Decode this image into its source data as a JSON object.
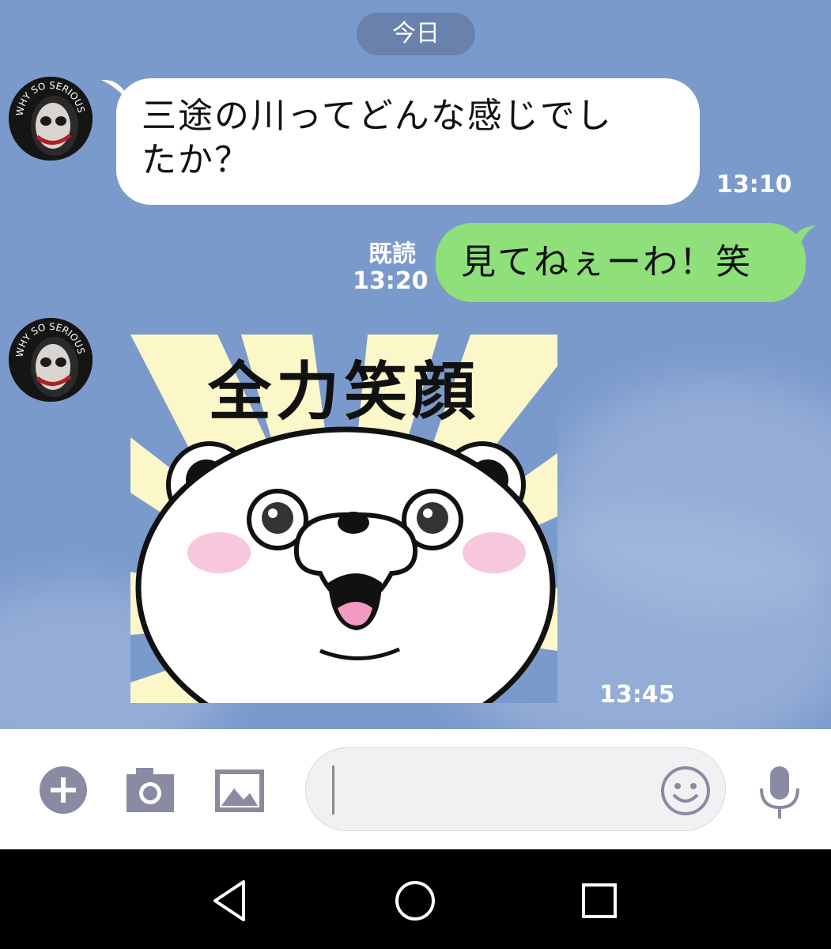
{
  "chat": {
    "date_divider": "今日",
    "messages": [
      {
        "direction": "incoming",
        "avatar_text": "WHY SO SERIOUS",
        "text_line1": "三途の川ってどんな感じでし",
        "text_line2": "たか？",
        "time": "13:10"
      },
      {
        "direction": "outgoing",
        "text": "見てねぇーわ！笑",
        "read_label": "既読",
        "time": "13:20"
      },
      {
        "direction": "incoming",
        "avatar_text": "WHY SO SERIOUS",
        "sticker_text": "全力笑顔",
        "time": "13:45"
      }
    ]
  },
  "input_bar": {
    "icons": [
      "plus-icon",
      "camera-icon",
      "image-icon",
      "emoji-icon",
      "microphone-icon"
    ],
    "text_value": ""
  },
  "nav_bar": {
    "icons": [
      "back-icon",
      "home-icon",
      "recents-icon"
    ]
  },
  "colors": {
    "chat_background": "#7b9acc",
    "outgoing_bubble": "#8fe07a",
    "incoming_bubble": "#ffffff",
    "icon_gray": "#8a8aa3"
  }
}
